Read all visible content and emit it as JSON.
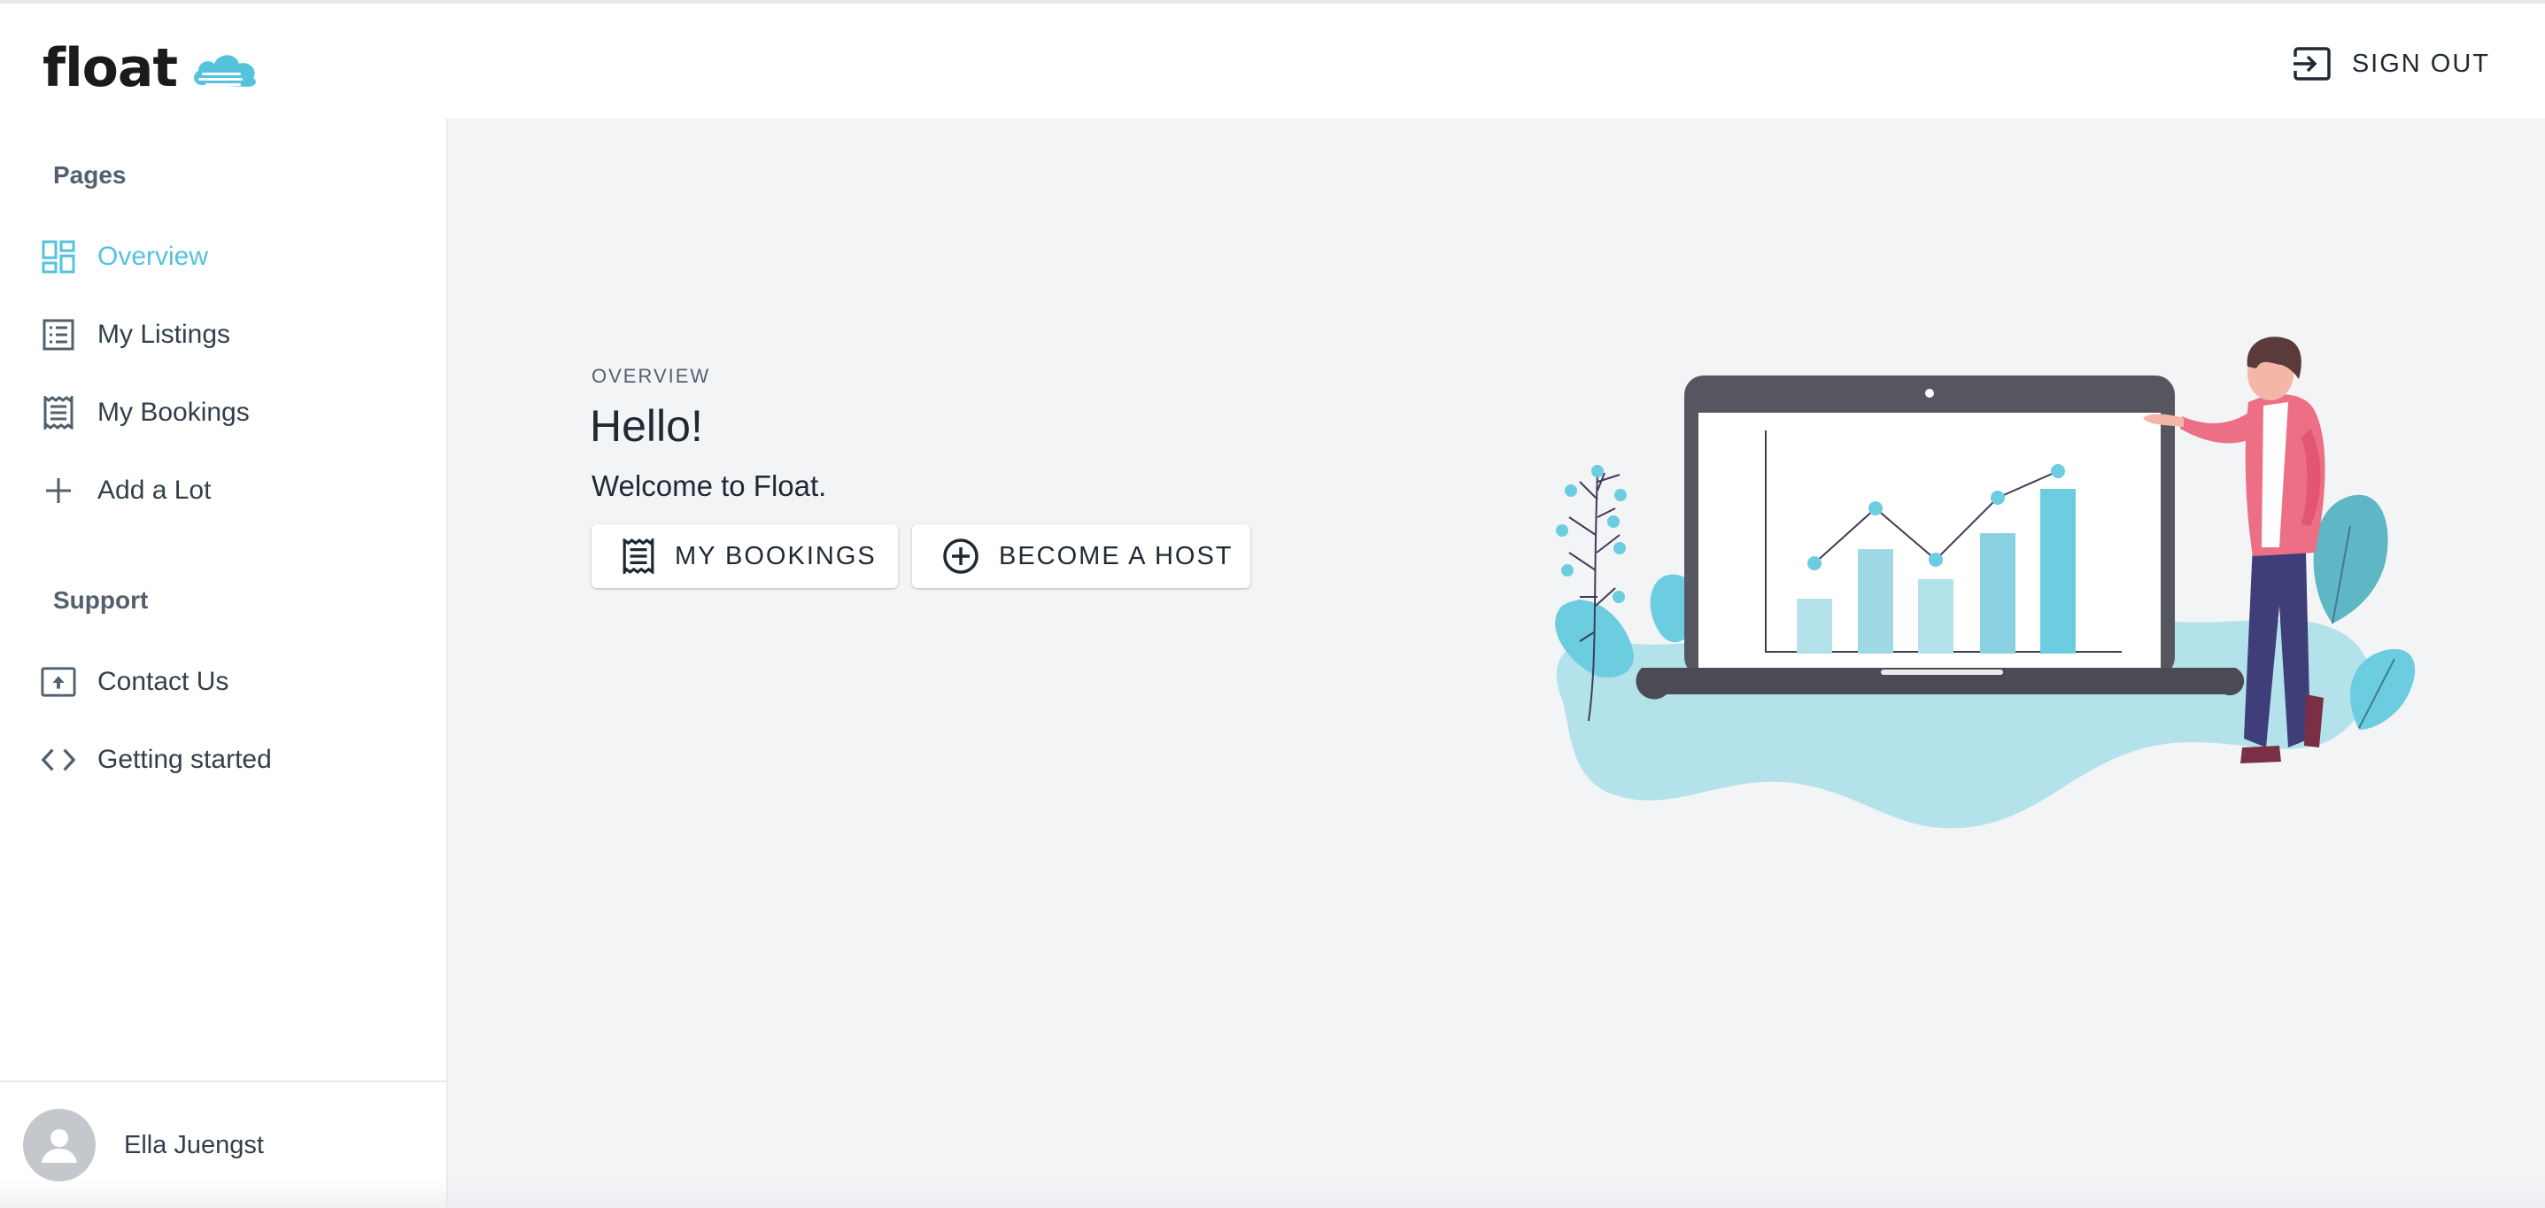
{
  "brand": {
    "name": "float",
    "accent_color": "#54c3dc",
    "cloud_icon": "cloud-icon"
  },
  "header": {
    "signout_label": "SIGN OUT",
    "signout_icon": "sign-out-icon"
  },
  "sidebar": {
    "pages_title": "Pages",
    "items": [
      {
        "label": "Overview",
        "icon": "dashboard-icon",
        "active": true
      },
      {
        "label": "My Listings",
        "icon": "list-icon",
        "active": false
      },
      {
        "label": "My Bookings",
        "icon": "receipt-icon",
        "active": false
      },
      {
        "label": "Add a Lot",
        "icon": "plus-icon",
        "active": false
      }
    ],
    "support_title": "Support",
    "support_items": [
      {
        "label": "Contact Us",
        "icon": "upload-box-icon"
      },
      {
        "label": "Getting started",
        "icon": "code-icon"
      }
    ],
    "user": {
      "name": "Ella Juengst",
      "icon": "person-icon"
    }
  },
  "main": {
    "overline": "OVERVIEW",
    "greeting": "Hello!",
    "welcome": "Welcome to Float.",
    "buttons": [
      {
        "label": "MY BOOKINGS",
        "icon": "receipt-icon"
      },
      {
        "label": "BECOME A HOST",
        "icon": "plus-circle-icon"
      }
    ]
  }
}
